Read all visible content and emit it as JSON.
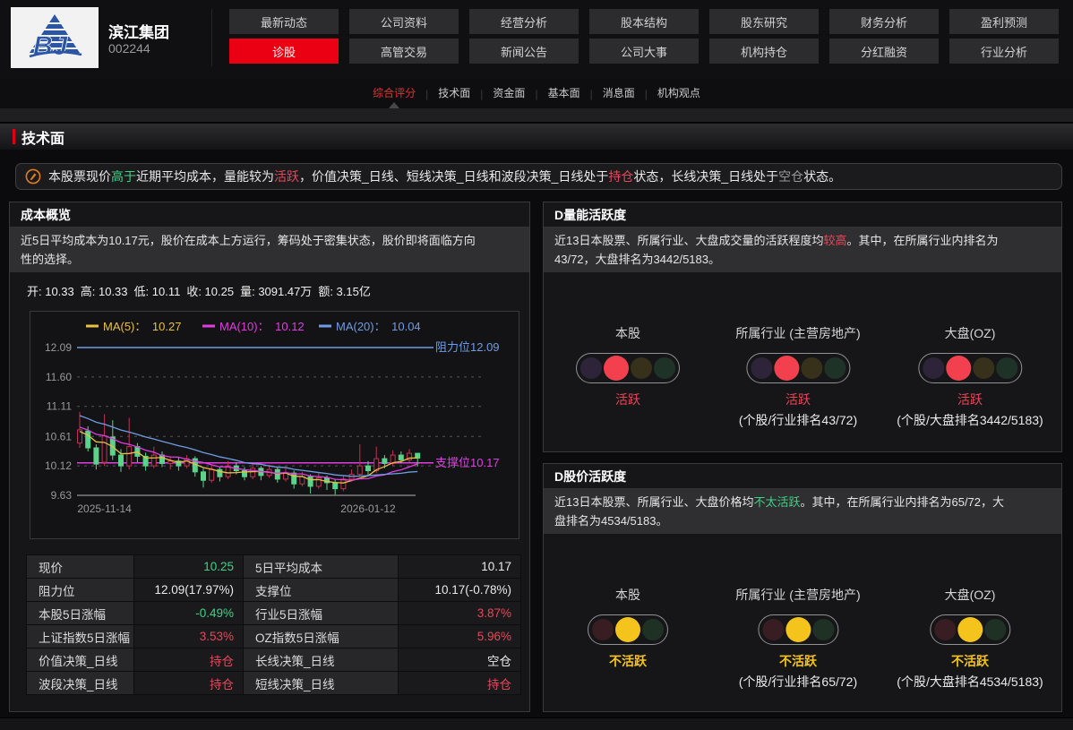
{
  "palette": {
    "red": "#e0404e",
    "green": "#43b954",
    "gray": "#9a9a9a",
    "yellow": "#f6c41c",
    "white": "#eaeaea",
    "accent_red": "#ea0013"
  },
  "header": {
    "company_name": "滨江集团",
    "company_code": "002244",
    "logo_letters": "BJ",
    "nav_rows": [
      [
        "最新动态",
        "公司资料",
        "经营分析",
        "股本结构",
        "股东研究",
        "财务分析",
        "盈利预测"
      ],
      [
        "诊股",
        "高管交易",
        "新闻公告",
        "公司大事",
        "机构持仓",
        "分红融资",
        "行业分析"
      ]
    ],
    "active_nav": "诊股"
  },
  "subnav": {
    "items": [
      "综合评分",
      "技术面",
      "资金面",
      "基本面",
      "消息面",
      "机构观点"
    ],
    "active_index": 0
  },
  "section": {
    "title": "技术面"
  },
  "summary": {
    "segments": [
      {
        "t": "本股票现价"
      },
      {
        "t": "高于",
        "c": "green"
      },
      {
        "t": "近期平均成本，量能较为"
      },
      {
        "t": "活跃",
        "c": "red"
      },
      {
        "t": "，价值决策_日线、短线决策_日线和波段决策_日线处于"
      },
      {
        "t": "持仓",
        "c": "red"
      },
      {
        "t": "状态，长线决策_日线处于"
      },
      {
        "t": "空仓",
        "c": "gray"
      },
      {
        "t": "状态。"
      }
    ]
  },
  "cost_panel": {
    "title": "成本概览",
    "desc_segments": [
      {
        "t": "近5日平均成本为10.17元，股价在成本上方运行，筹码处于密集状态，股价即将面临方向"
      },
      {
        "br": true
      },
      {
        "t": "性的选择。"
      }
    ],
    "ohlc": [
      [
        "开",
        "10.33"
      ],
      [
        "高",
        "10.33"
      ],
      [
        "低",
        "10.11"
      ],
      [
        "收",
        "10.25"
      ],
      [
        "量",
        "3091.47万"
      ],
      [
        "额",
        "3.15亿"
      ]
    ],
    "chart_data": {
      "type": "candlestick",
      "legend": [
        [
          "MA(5)",
          "10.27",
          "#e6c143"
        ],
        [
          "MA(10)",
          "10.12",
          "#e23ce2"
        ],
        [
          "MA(20)",
          "10.04",
          "#6f9ce2"
        ]
      ],
      "y_ticks": [
        "12.09",
        "11.60",
        "11.11",
        "10.61",
        "10.12",
        "9.63"
      ],
      "x_ticks": [
        {
          "index": 3,
          "label": "2025-11-14"
        },
        {
          "index": 35,
          "label": "2026-01-12"
        }
      ],
      "resistance": {
        "value": 12.09,
        "label": "阻力位12.09",
        "color": "#6f9ce2"
      },
      "support": {
        "value": 10.17,
        "label": "支撑位10.17",
        "color": "#e23ce2"
      },
      "up_color": "#bf3550",
      "down_color": "#5bd38b",
      "axis_color": "#808080",
      "grid_color": "#555558",
      "tick_color": "#9a9a9e",
      "ma_history": [
        11.45,
        11.4,
        11.35,
        11.3,
        11.22,
        11.15,
        11.1,
        11.05,
        11.0,
        10.97,
        10.94,
        10.9,
        10.87,
        10.84,
        10.8,
        10.77,
        10.74,
        10.7,
        10.67,
        10.64
      ],
      "candles": [
        [
          10.5,
          11.02,
          10.42,
          10.72
        ],
        [
          10.7,
          10.78,
          10.36,
          10.42
        ],
        [
          10.42,
          10.48,
          10.06,
          10.15
        ],
        [
          10.18,
          10.98,
          10.12,
          10.62
        ],
        [
          10.6,
          10.88,
          10.22,
          10.3
        ],
        [
          10.3,
          10.4,
          10.02,
          10.12
        ],
        [
          10.12,
          10.92,
          10.06,
          10.44
        ],
        [
          10.44,
          10.5,
          10.18,
          10.28
        ],
        [
          10.28,
          10.34,
          10.04,
          10.12
        ],
        [
          10.12,
          10.44,
          10.08,
          10.3
        ],
        [
          10.3,
          10.36,
          10.1,
          10.16
        ],
        [
          10.16,
          10.28,
          10.06,
          10.2
        ],
        [
          10.2,
          10.26,
          10.04,
          10.12
        ],
        [
          10.12,
          10.3,
          10.08,
          10.24
        ],
        [
          10.24,
          10.28,
          9.94,
          10.02
        ],
        [
          10.02,
          10.08,
          9.76,
          9.88
        ],
        [
          9.88,
          10.14,
          9.84,
          10.06
        ],
        [
          10.06,
          10.1,
          9.86,
          9.94
        ],
        [
          9.94,
          10.2,
          9.9,
          10.12
        ],
        [
          10.12,
          10.18,
          9.98,
          10.04
        ],
        [
          10.04,
          10.1,
          9.88,
          9.94
        ],
        [
          9.94,
          10.16,
          9.9,
          10.08
        ],
        [
          10.08,
          10.12,
          9.88,
          9.96
        ],
        [
          9.96,
          10.14,
          9.92,
          10.06
        ],
        [
          10.06,
          10.1,
          9.84,
          9.9
        ],
        [
          9.9,
          10.08,
          9.86,
          10.0
        ],
        [
          10.0,
          10.04,
          9.74,
          9.82
        ],
        [
          9.82,
          10.02,
          9.78,
          9.94
        ],
        [
          9.94,
          9.98,
          9.66,
          9.78
        ],
        [
          9.78,
          10.0,
          9.74,
          9.92
        ],
        [
          9.92,
          9.96,
          9.72,
          9.84
        ],
        [
          9.84,
          9.9,
          9.64,
          9.74
        ],
        [
          9.74,
          9.96,
          9.7,
          9.9
        ],
        [
          9.9,
          10.06,
          9.86,
          9.98
        ],
        [
          9.98,
          10.48,
          9.94,
          10.12
        ],
        [
          10.12,
          10.2,
          9.96,
          10.04
        ],
        [
          10.04,
          10.44,
          10.0,
          10.24
        ],
        [
          10.24,
          10.3,
          10.08,
          10.16
        ],
        [
          10.16,
          10.38,
          10.12,
          10.3
        ],
        [
          10.3,
          10.36,
          10.16,
          10.22
        ],
        [
          10.22,
          10.4,
          10.18,
          10.33
        ],
        [
          10.33,
          10.33,
          10.11,
          10.25
        ]
      ]
    },
    "table": {
      "rows": [
        [
          [
            "现价",
            "10.25",
            "green"
          ],
          [
            "5日平均成本",
            "10.17",
            "white"
          ]
        ],
        [
          [
            "阻力位",
            "12.09(17.97%)",
            "white"
          ],
          [
            "支撑位",
            "10.17(-0.78%)",
            "white"
          ]
        ],
        [
          [
            "本股5日涨幅",
            "-0.49%",
            "green"
          ],
          [
            "行业5日涨幅",
            "3.87%",
            "red"
          ]
        ],
        [
          [
            "上证指数5日涨幅",
            "3.53%",
            "red"
          ],
          [
            "OZ指数5日涨幅",
            "5.96%",
            "red"
          ]
        ],
        [
          [
            "价值决策_日线",
            "持仓",
            "red"
          ],
          [
            "长线决策_日线",
            "空仓",
            "white"
          ]
        ],
        [
          [
            "波段决策_日线",
            "持仓",
            "red"
          ],
          [
            "短线决策_日线",
            "持仓",
            "red"
          ]
        ]
      ]
    }
  },
  "volume_panel": {
    "title": "D量能活跃度",
    "desc_segments": [
      {
        "t": "近13日本股票、所属行业、大盘成交量的活跃程度均"
      },
      {
        "t": "较高",
        "c": "red"
      },
      {
        "t": "。其中，在所属行业内排名为"
      },
      {
        "br": true
      },
      {
        "t": "43/72，大盘排名为3442/5183。"
      }
    ],
    "groups": [
      {
        "title": "本股",
        "lights": [
          "#2e2439",
          "#f2404e",
          "#37301b",
          "#1f3227"
        ],
        "active": 1,
        "status": "活跃",
        "status_color": "red",
        "rank": ""
      },
      {
        "title": "所属行业 (主营房地产)",
        "lights": [
          "#2e2439",
          "#f2404e",
          "#37301b",
          "#1f3227"
        ],
        "active": 1,
        "status": "活跃",
        "status_color": "red",
        "rank": "(个股/行业排名43/72)"
      },
      {
        "title": "大盘(OZ)",
        "lights": [
          "#2e2439",
          "#f2404e",
          "#37301b",
          "#1f3227"
        ],
        "active": 1,
        "status": "活跃",
        "status_color": "red",
        "rank": "(个股/大盘排名3442/5183)"
      }
    ]
  },
  "price_panel": {
    "title": "D股价活跃度",
    "desc_segments": [
      {
        "t": "近13日本股票、所属行业、大盘价格均"
      },
      {
        "t": "不太活跃",
        "c": "green"
      },
      {
        "t": "。其中，在所属行业内排名为65/72，大"
      },
      {
        "br": true
      },
      {
        "t": "盘排名为4534/5183。"
      }
    ],
    "groups": [
      {
        "title": "本股",
        "lights": [
          "#381d23",
          "#f5c41c",
          "#1f3125"
        ],
        "active": 1,
        "status": "不活跃",
        "status_color": "yellow",
        "rank": ""
      },
      {
        "title": "所属行业 (主营房地产)",
        "lights": [
          "#381d23",
          "#f5c41c",
          "#1f3125"
        ],
        "active": 1,
        "status": "不活跃",
        "status_color": "yellow",
        "rank": "(个股/行业排名65/72)"
      },
      {
        "title": "大盘(OZ)",
        "lights": [
          "#381d23",
          "#f5c41c",
          "#1f3125"
        ],
        "active": 1,
        "status": "不活跃",
        "status_color": "yellow",
        "rank": "(个股/大盘排名4534/5183)"
      }
    ]
  }
}
